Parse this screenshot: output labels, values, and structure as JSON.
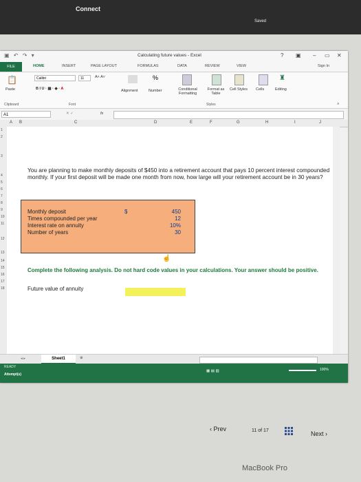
{
  "browser": {
    "top_title": "Connect",
    "saved": "Saved"
  },
  "window": {
    "title": "Calculating future values - Excel",
    "help": "?",
    "sign_in": "Sign In"
  },
  "ribbon": {
    "tabs": [
      "FILE",
      "HOME",
      "INSERT",
      "PAGE LAYOUT",
      "FORMULAS",
      "DATA",
      "REVIEW",
      "VIEW"
    ],
    "font_name": "Calibri",
    "font_size": "11",
    "paste": "Paste",
    "alignment": "Alignment",
    "number": "Number",
    "percent": "%",
    "conditional": "Conditional Formatting",
    "format_table": "Format as Table",
    "cell_styles": "Cell Styles",
    "cells": "Cells",
    "editing": "Editing",
    "groups": [
      "Clipboard",
      "Font",
      "Styles"
    ]
  },
  "formula_bar": {
    "name_box": "A1",
    "fx": "fx"
  },
  "columns": [
    "A",
    "B",
    "C",
    "D",
    "E",
    "F",
    "G",
    "H",
    "I",
    "J"
  ],
  "rows": [
    "1",
    "2",
    "3",
    "4",
    "5",
    "6",
    "7",
    "8",
    "9",
    "10",
    "11",
    "12",
    "13",
    "14",
    "15",
    "16",
    "17",
    "18"
  ],
  "sheet": {
    "problem": "You are planning to make monthly deposits of $450 into a retirement account that pays 10 percent interest compounded monthly. If your first deposit will be made one month from now, how large will your retirement account be in 30 years?",
    "inputs": [
      {
        "label": "Monthly deposit",
        "value": "450"
      },
      {
        "label": "Times compounded per year",
        "value": "12"
      },
      {
        "label": "Interest rate on annuity",
        "value": "10%"
      },
      {
        "label": "Number of years",
        "value": "30"
      }
    ],
    "currency": "$",
    "instruction": "Complete the following analysis. Do not hard code values in your calculations. Your answer should be positive.",
    "output_label": "Future value of annuity",
    "tab_name": "Sheet1"
  },
  "status": {
    "ready": "READY",
    "attempts": "Attempt(s)",
    "zoom": "100%"
  },
  "nav": {
    "prev": "Prev",
    "page": "11 of 17",
    "next": "Next"
  },
  "device": "MacBook Pro",
  "colors": {
    "excel_green": "#217346",
    "input_box": "#f6ae7c",
    "answer_cell": "#f4f25a",
    "instruction": "#1e7a3a"
  }
}
